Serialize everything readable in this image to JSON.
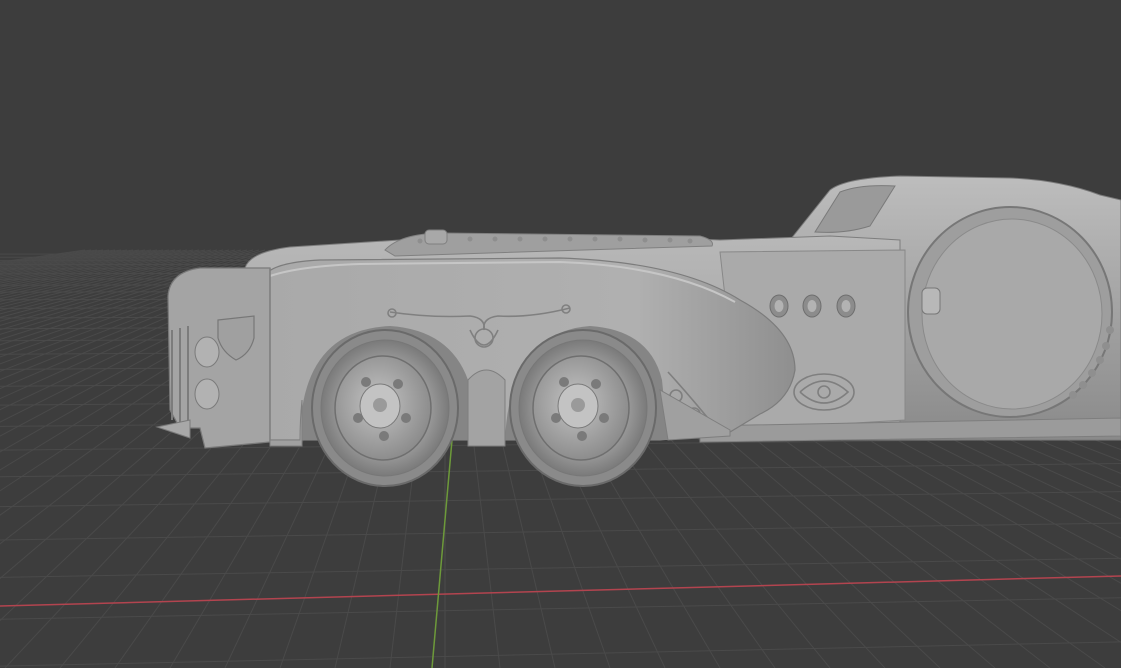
{
  "viewport": {
    "background_color": "#3d3d3d",
    "grid_color": "#4a4a4a",
    "x_axis_color": "#b3444f",
    "y_axis_color": "#6d9a3a",
    "model_base_color": "#a3a3a3",
    "model_shadow_color": "#7c7c7c",
    "model_highlight_color": "#c2c2c2"
  },
  "object": {
    "icon": "car-model-icon"
  }
}
